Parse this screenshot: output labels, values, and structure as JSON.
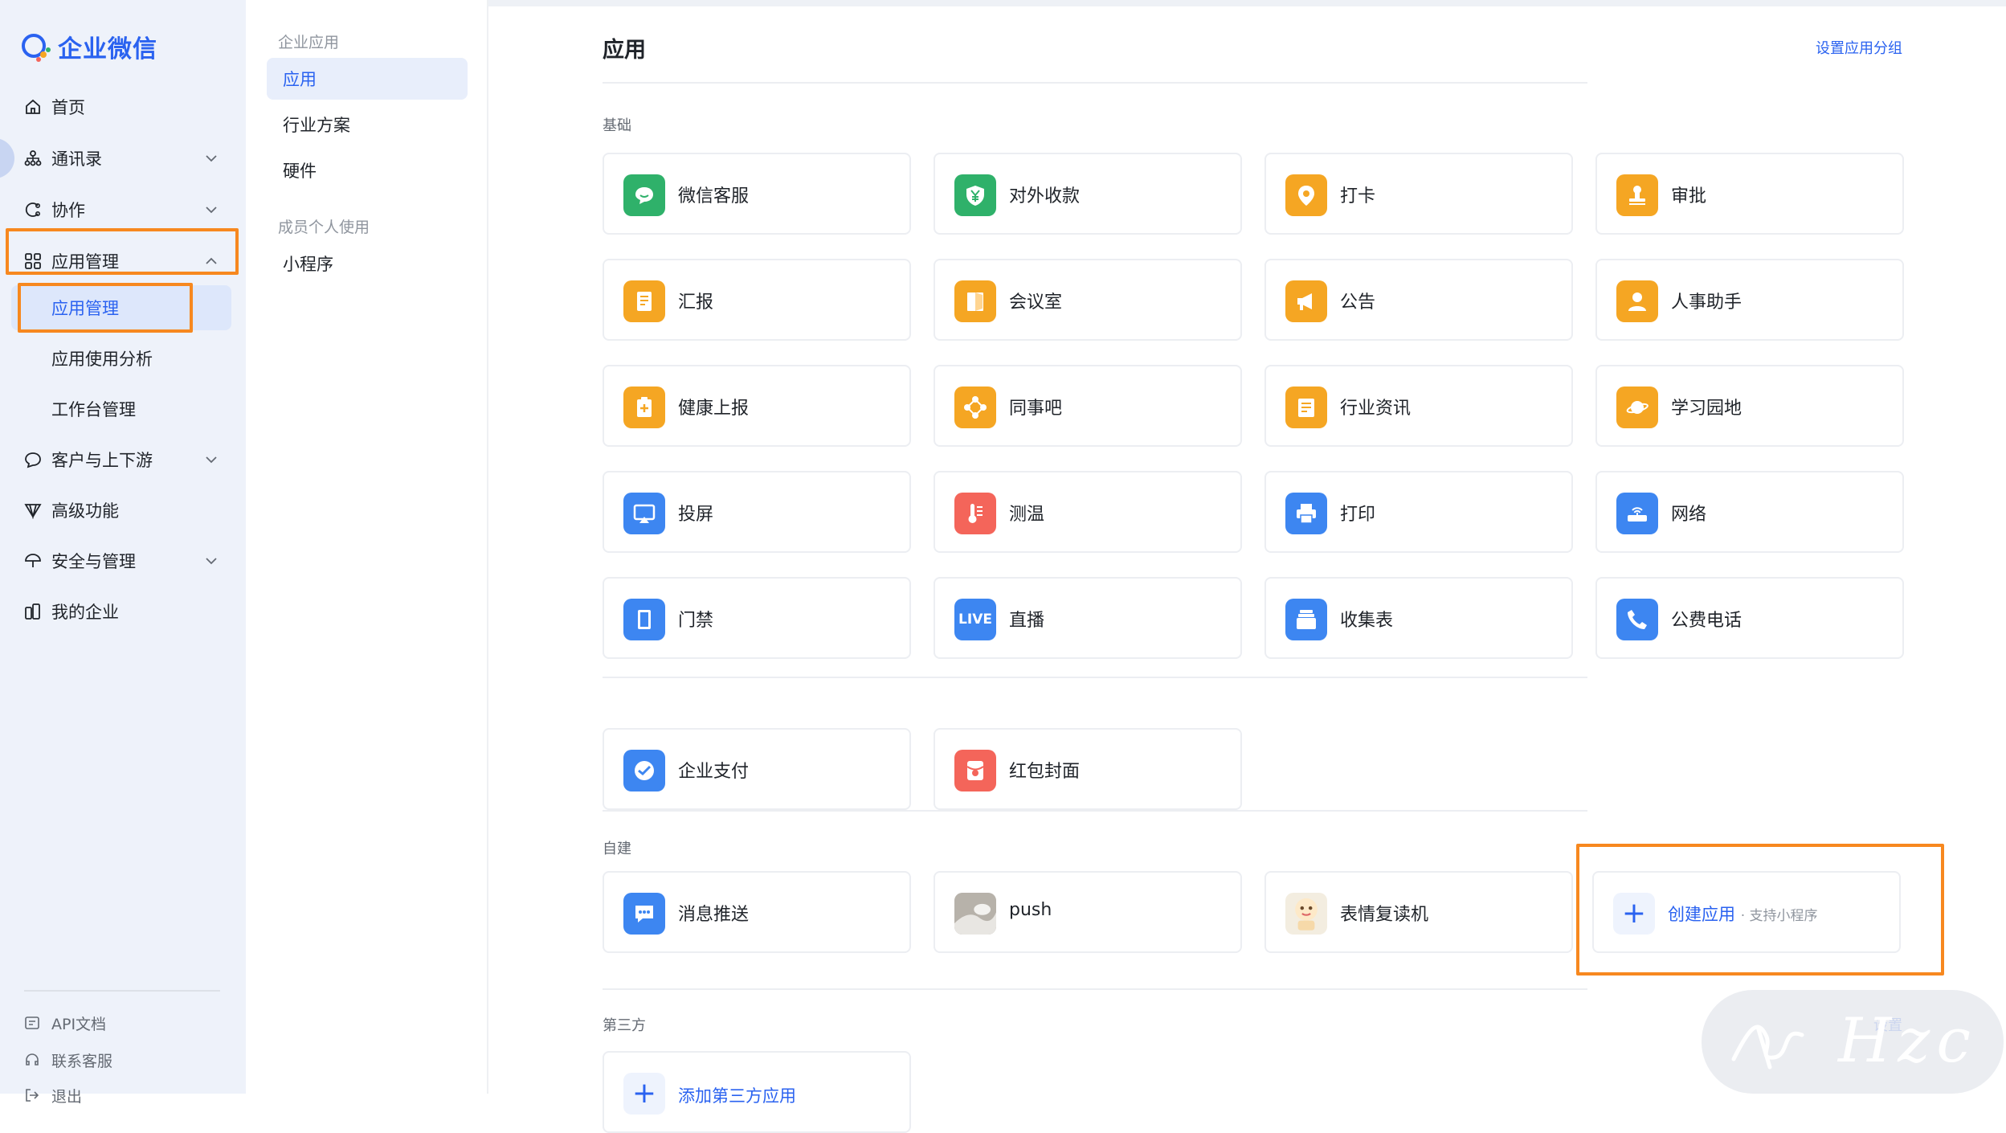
{
  "brand": {
    "logo_text": "企业微信"
  },
  "nav": {
    "items": [
      {
        "label": "首页",
        "icon": "home-icon"
      },
      {
        "label": "通讯录",
        "icon": "org-chart-icon"
      },
      {
        "label": "协作",
        "icon": "collab-icon"
      },
      {
        "label": "应用管理",
        "icon": "apps-grid-icon"
      },
      {
        "label": "客户与上下游",
        "icon": "chat-bubble-icon"
      },
      {
        "label": "高级功能",
        "icon": "diamond-icon"
      },
      {
        "label": "安全与管理",
        "icon": "umbrella-icon"
      },
      {
        "label": "我的企业",
        "icon": "building-icon"
      }
    ],
    "sub_items": [
      {
        "label": "应用管理"
      },
      {
        "label": "应用使用分析"
      },
      {
        "label": "工作台管理"
      }
    ],
    "footer": [
      {
        "label": "API文档"
      },
      {
        "label": "联系客服"
      },
      {
        "label": "退出"
      }
    ]
  },
  "nav2": {
    "group1": "企业应用",
    "group1_items": [
      "应用",
      "行业方案",
      "硬件"
    ],
    "group2": "成员个人使用",
    "group2_items": [
      "小程序"
    ]
  },
  "main": {
    "title": "应用",
    "set_groups_link": "设置应用分组",
    "sections": {
      "basic": "基础",
      "custom": "自建",
      "third": "第三方"
    },
    "third_settings_link": "设置",
    "basic_apps": [
      {
        "name": "微信客服",
        "color": "#2fb16a",
        "icon": "wechat-service-icon"
      },
      {
        "name": "对外收款",
        "color": "#2fb16a",
        "icon": "yen-shield-icon"
      },
      {
        "name": "打卡",
        "color": "#f5a623",
        "icon": "location-pin-icon"
      },
      {
        "name": "审批",
        "color": "#f5a623",
        "icon": "stamp-icon"
      },
      {
        "name": "汇报",
        "color": "#f5a623",
        "icon": "report-doc-icon"
      },
      {
        "name": "会议室",
        "color": "#f5a623",
        "icon": "door-icon"
      },
      {
        "name": "公告",
        "color": "#f5a623",
        "icon": "megaphone-icon"
      },
      {
        "name": "人事助手",
        "color": "#f5a623",
        "icon": "person-icon"
      },
      {
        "name": "健康上报",
        "color": "#f5a623",
        "icon": "health-clipboard-icon"
      },
      {
        "name": "同事吧",
        "color": "#f5a623",
        "icon": "network-nodes-icon"
      },
      {
        "name": "行业资讯",
        "color": "#f5a623",
        "icon": "news-icon"
      },
      {
        "name": "学习园地",
        "color": "#f5a623",
        "icon": "planet-icon"
      },
      {
        "name": "投屏",
        "color": "#3d86f1",
        "icon": "screen-cast-icon"
      },
      {
        "name": "测温",
        "color": "#f4655a",
        "icon": "thermometer-icon"
      },
      {
        "name": "打印",
        "color": "#3d86f1",
        "icon": "printer-icon"
      },
      {
        "name": "网络",
        "color": "#3d86f1",
        "icon": "router-icon"
      },
      {
        "name": "门禁",
        "color": "#3d86f1",
        "icon": "access-door-icon"
      },
      {
        "name": "直播",
        "color": "#3d86f1",
        "icon": "live-icon",
        "badge_text": "LIVE"
      },
      {
        "name": "收集表",
        "color": "#3d86f1",
        "icon": "form-stack-icon"
      },
      {
        "name": "公费电话",
        "color": "#3d86f1",
        "icon": "phone-icon"
      }
    ],
    "pay_apps": [
      {
        "name": "企业支付",
        "color": "#3d86f1",
        "icon": "pay-icon"
      },
      {
        "name": "红包封面",
        "color": "#f4655a",
        "icon": "red-packet-icon"
      }
    ],
    "custom_apps": [
      {
        "name": "消息推送",
        "color": "#3d86f1",
        "icon": "message-push-icon"
      },
      {
        "name": "push",
        "color": "#c9c9c9",
        "icon": "photo-thumb-icon"
      },
      {
        "name": "表情复读机",
        "color": "#f3ede0",
        "icon": "sticker-thumb-icon"
      }
    ],
    "create_app": {
      "label": "创建应用",
      "sub": "· 支持小程序"
    },
    "add_third_app": {
      "label": "添加第三方应用"
    }
  },
  "watermark": {
    "text": "Hzc"
  }
}
